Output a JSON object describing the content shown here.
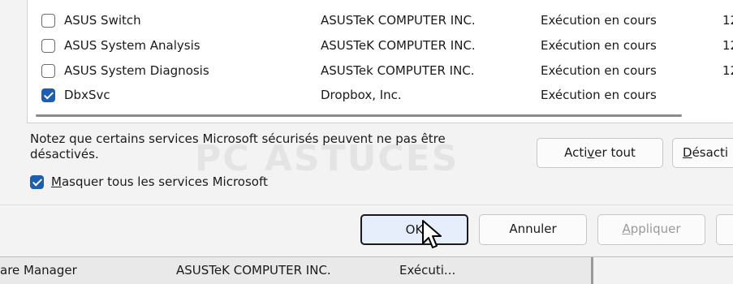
{
  "services": [
    {
      "name": "ASUS Switch",
      "maker": "ASUSTeK COMPUTER INC.",
      "status": "Exécution en cours",
      "date": "12",
      "checked": false
    },
    {
      "name": "ASUS System Analysis",
      "maker": "ASUSTeK COMPUTER INC.",
      "status": "Exécution en cours",
      "date": "12",
      "checked": false
    },
    {
      "name": "ASUS System Diagnosis",
      "maker": "ASUSTek COMPUTER INC.",
      "status": "Exécution en cours",
      "date": "12",
      "checked": false
    },
    {
      "name": "DbxSvc",
      "maker": "Dropbox, Inc.",
      "status": "Exécution en cours",
      "date": "",
      "checked": true
    }
  ],
  "note": "Notez que certains services Microsoft sécurisés peuvent ne pas être désactivés.",
  "hide_ms": {
    "mnemonic": "M",
    "rest": "asquer tous les services Microsoft",
    "checked": true
  },
  "buttons": {
    "enable_pre": "Acti",
    "enable_mn": "v",
    "enable_post": "er tout",
    "disable_pre": "",
    "disable_mn": "D",
    "disable_post": "ésacti",
    "ok": "OK",
    "cancel": "Annuler",
    "apply_mn": "A",
    "apply_post": "ppliquer"
  },
  "background_row": {
    "name": "are Manager",
    "maker": "ASUSTeK COMPUTER INC.",
    "status": "Exécuti..."
  },
  "watermark": "PC ASTUCES"
}
